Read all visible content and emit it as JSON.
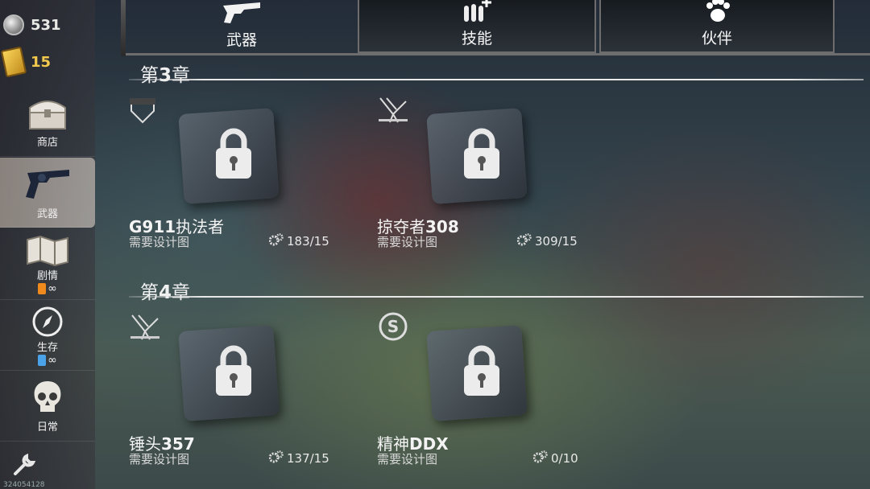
{
  "currency": {
    "silver": "531",
    "gold": "15"
  },
  "sidebar": {
    "items": [
      {
        "label": "商店",
        "icon": "chest-icon"
      },
      {
        "label": "武器",
        "icon": "revolver-icon"
      },
      {
        "label": "剧情",
        "icon": "map-icon",
        "energy": "∞"
      },
      {
        "label": "生存",
        "icon": "compass-icon",
        "energy": "∞"
      },
      {
        "label": "日常",
        "icon": "skull-icon"
      }
    ],
    "settings_icon": "wrench-icon",
    "build_id": "324054128"
  },
  "tabs": [
    {
      "label": "武器",
      "icon": "revolver-icon",
      "active": true
    },
    {
      "label": "技能",
      "icon": "ammo-plus-icon",
      "active": false
    },
    {
      "label": "伙伴",
      "icon": "paw-icon",
      "active": false
    }
  ],
  "chapters": [
    {
      "prefix": "第",
      "number": "3",
      "suffix": "章",
      "weapons": [
        {
          "brand": "GOODWIN",
          "name_cn": "G911执法者",
          "name_a": "G911",
          "name_b": "执法者",
          "requirement": "需要设计图",
          "progress": "183/15",
          "locked": true
        },
        {
          "brand": "HERRINGTON",
          "name_a": "掠夺者",
          "name_b": "308",
          "requirement": "需要设计图",
          "progress": "309/15",
          "locked": true
        }
      ]
    },
    {
      "prefix": "第",
      "number": "4",
      "suffix": "章",
      "weapons": [
        {
          "brand": "HERRINGTON",
          "name_a": "锤头",
          "name_b": "357",
          "requirement": "需要设计图",
          "progress": "137/15",
          "locked": true
        },
        {
          "brand": "S",
          "name_a": "精神",
          "name_b": "DDX",
          "requirement": "需要设计图",
          "progress": "0/10",
          "locked": true
        }
      ]
    }
  ],
  "colors": {
    "gold": "#f2c94c",
    "active_nav": "#d9cbbd",
    "tab_border": "#6d6d6d"
  }
}
